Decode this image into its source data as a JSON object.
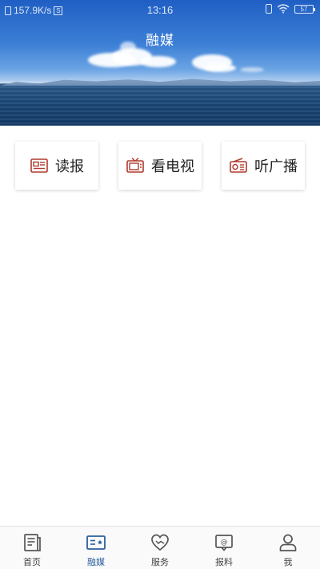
{
  "status_bar": {
    "network_speed": "157.9K/s",
    "s_badge": "S",
    "time": "13:16",
    "battery": "57"
  },
  "header": {
    "title": "融媒"
  },
  "cards": [
    {
      "label": "读报",
      "icon": "newspaper-icon"
    },
    {
      "label": "看电视",
      "icon": "tv-icon"
    },
    {
      "label": "听广播",
      "icon": "radio-icon"
    }
  ],
  "tabs": [
    {
      "label": "首页",
      "icon": "home-doc-icon",
      "active": false
    },
    {
      "label": "融媒",
      "icon": "media-card-icon",
      "active": true
    },
    {
      "label": "服务",
      "icon": "heart-service-icon",
      "active": false
    },
    {
      "label": "报料",
      "icon": "report-chat-icon",
      "active": false
    },
    {
      "label": "我",
      "icon": "user-icon",
      "active": false
    }
  ],
  "colors": {
    "accent": "#2a5f9e",
    "card_icon": "#b03a2e"
  }
}
